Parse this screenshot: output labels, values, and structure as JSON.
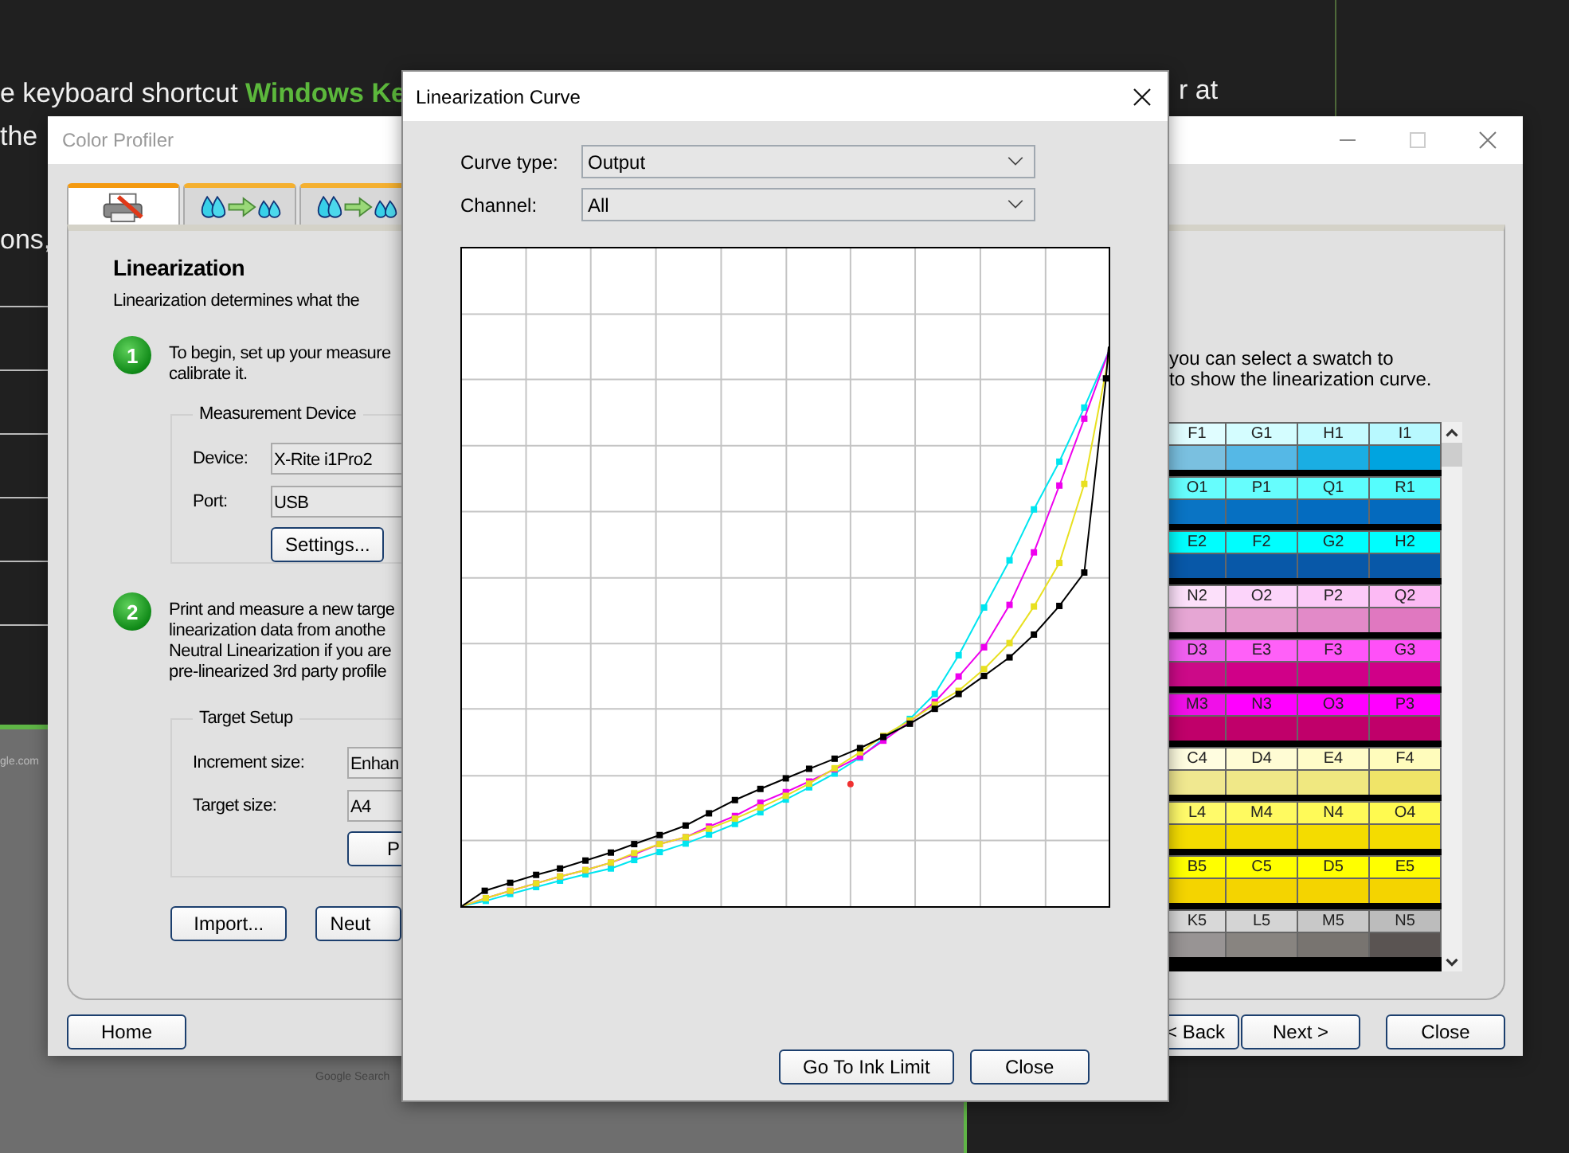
{
  "background": {
    "lines": [
      "e keyboard shortcut **Windows Ke**",
      "the",
      "ons,"
    ],
    "right_text": "r at",
    "browser_texts": [
      "gle.com",
      "Google Search"
    ]
  },
  "profiler": {
    "title": "Color Profiler",
    "tabs": [
      {
        "kind": "printer",
        "selected": true
      },
      {
        "kind": "drops",
        "selected": false
      },
      {
        "kind": "drops",
        "selected": false
      }
    ],
    "heading": "Linearization",
    "description": "Linearization determines what the",
    "steps": [
      {
        "number": "1",
        "lines": [
          "To begin, set up your measure",
          "calibrate it."
        ]
      },
      {
        "number": "2",
        "lines": [
          "Print and measure a new targe",
          "linearization data from anothe",
          "Neutral Linearization if you are",
          "pre-linearized 3rd party profile"
        ]
      }
    ],
    "measurement_device": {
      "legend": "Measurement Device",
      "fields": [
        {
          "label": "Device:",
          "value": "X-Rite i1Pro2"
        },
        {
          "label": "Port:",
          "value": "USB"
        }
      ],
      "button": "Settings..."
    },
    "target_setup": {
      "legend": "Target Setup",
      "fields": [
        {
          "label": "Increment size:",
          "value": "Enhan"
        },
        {
          "label": "Target size:",
          "value": "A4"
        }
      ],
      "button": "P"
    },
    "action_buttons": [
      "Import...",
      "Neut"
    ],
    "instruction": [
      "you can select a swatch to",
      "to show the linearization curve."
    ],
    "swatch_rows": [
      {
        "labels": [
          {
            "text": "F1",
            "color": "#e0fdff"
          },
          {
            "text": "G1",
            "color": "#d4fdff"
          },
          {
            "text": "H1",
            "color": "#c4fbff"
          },
          {
            "text": "I1",
            "color": "#b8f9ff"
          }
        ],
        "swatches": [
          {
            "color": "#7ac0e0"
          },
          {
            "color": "#55b8e6"
          },
          {
            "color": "#1aaee3"
          },
          {
            "color": "#00a4e0"
          }
        ]
      },
      {
        "labels": [
          {
            "text": "O1",
            "color": "#66fdfd"
          },
          {
            "text": "P1",
            "color": "#66fdfd"
          },
          {
            "text": "Q1",
            "color": "#5cfdfd"
          },
          {
            "text": "R1",
            "color": "#55fdfd"
          }
        ],
        "swatches": [
          {
            "color": "#0a74c4"
          },
          {
            "color": "#0670c2"
          },
          {
            "color": "#046cc0"
          },
          {
            "color": "#046abe"
          }
        ]
      },
      {
        "labels": [
          {
            "text": "E2",
            "color": "#00fefe"
          },
          {
            "text": "F2",
            "color": "#00fefe"
          },
          {
            "text": "G2",
            "color": "#00fefe"
          },
          {
            "text": "H2",
            "color": "#00fefe"
          }
        ],
        "swatches": [
          {
            "color": "#0858a8"
          },
          {
            "color": "#0858a8"
          },
          {
            "color": "#0858a8"
          },
          {
            "color": "#0858a8"
          }
        ]
      },
      {
        "labels": [
          {
            "text": "N2",
            "color": "#fce0fa"
          },
          {
            "text": "O2",
            "color": "#fcd4fa"
          },
          {
            "text": "P2",
            "color": "#fccaf8"
          },
          {
            "text": "Q2",
            "color": "#fcbaf4"
          }
        ],
        "swatches": [
          {
            "color": "#e6a6d4"
          },
          {
            "color": "#e69ace"
          },
          {
            "color": "#e28ac8"
          },
          {
            "color": "#e078c0"
          }
        ]
      },
      {
        "labels": [
          {
            "text": "D3",
            "color": "#f060f0"
          },
          {
            "text": "E3",
            "color": "#ff60f8"
          },
          {
            "text": "F3",
            "color": "#ff55f8"
          },
          {
            "text": "G3",
            "color": "#ff50f8"
          }
        ],
        "swatches": [
          {
            "color": "#cc0a88"
          },
          {
            "color": "#d00088"
          },
          {
            "color": "#d00088"
          },
          {
            "color": "#d00088"
          }
        ]
      },
      {
        "labels": [
          {
            "text": "M3",
            "color": "#f010e8"
          },
          {
            "text": "N3",
            "color": "#ff00ff"
          },
          {
            "text": "O3",
            "color": "#ff00ff"
          },
          {
            "text": "P3",
            "color": "#ff00ff"
          }
        ],
        "swatches": [
          {
            "color": "#c0006a"
          },
          {
            "color": "#c0006a"
          },
          {
            "color": "#c0006a"
          },
          {
            "color": "#c0006a"
          }
        ]
      },
      {
        "labels": [
          {
            "text": "C4",
            "color": "#fffde0"
          },
          {
            "text": "D4",
            "color": "#fffcd4"
          },
          {
            "text": "E4",
            "color": "#fffcc8"
          },
          {
            "text": "F4",
            "color": "#fffcbc"
          }
        ],
        "swatches": [
          {
            "color": "#f0e890"
          },
          {
            "color": "#f0e888"
          },
          {
            "color": "#f0e880"
          },
          {
            "color": "#f0e468"
          }
        ]
      },
      {
        "labels": [
          {
            "text": "L4",
            "color": "#fffa6a"
          },
          {
            "text": "M4",
            "color": "#fffa60"
          },
          {
            "text": "N4",
            "color": "#fffa58"
          },
          {
            "text": "O4",
            "color": "#fffa50"
          }
        ],
        "swatches": [
          {
            "color": "#f4dc00"
          },
          {
            "color": "#f4dc00"
          },
          {
            "color": "#f4dc00"
          },
          {
            "color": "#f4dc00"
          }
        ]
      },
      {
        "labels": [
          {
            "text": "B5",
            "color": "#ffff00"
          },
          {
            "text": "C5",
            "color": "#ffff00"
          },
          {
            "text": "D5",
            "color": "#ffff00"
          },
          {
            "text": "E5",
            "color": "#ffff00"
          }
        ],
        "swatches": [
          {
            "color": "#f4d400"
          },
          {
            "color": "#f4d400"
          },
          {
            "color": "#f4d400"
          },
          {
            "color": "#f4d400"
          }
        ]
      },
      {
        "labels": [
          {
            "text": "K5",
            "color": "#d8d8d8"
          },
          {
            "text": "L5",
            "color": "#d4d4d4"
          },
          {
            "text": "M5",
            "color": "#c8c8c8"
          },
          {
            "text": "N5",
            "color": "#bcbcbc"
          }
        ],
        "swatches": [
          {
            "color": "#989494"
          },
          {
            "color": "#888480"
          },
          {
            "color": "#787470"
          },
          {
            "color": "#5a5452"
          }
        ]
      }
    ],
    "footer_left": [
      "Home"
    ],
    "footer_right": [
      "< Back",
      "Next >",
      "Close"
    ]
  },
  "dialog": {
    "title": "Linearization Curve",
    "fields": [
      {
        "label": "Curve type:",
        "value": "Output"
      },
      {
        "label": "Channel:",
        "value": "All"
      }
    ],
    "buttons": [
      "Go To Ink Limit",
      "Close"
    ]
  }
}
